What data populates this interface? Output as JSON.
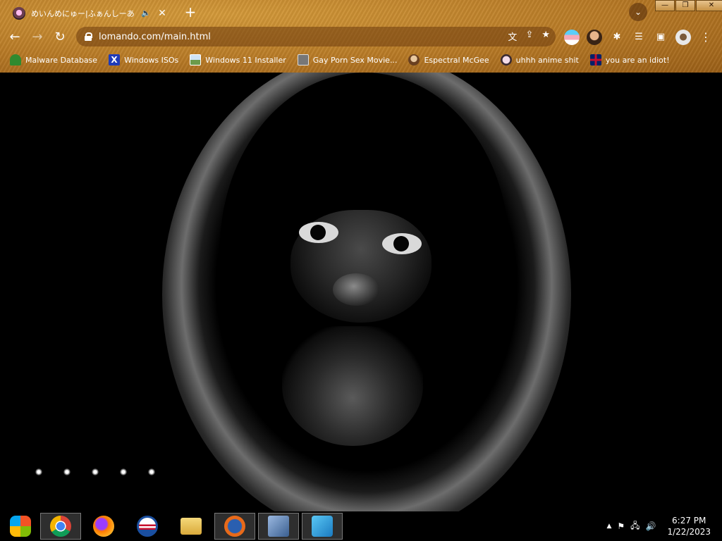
{
  "tab": {
    "title": "めいんめにゅー|ふぁんしーあいらんど",
    "audio_icon": "speaker-icon",
    "close_glyph": "✕"
  },
  "newtab_glyph": "+",
  "tabsearch_glyph": "⌄",
  "window_controls": {
    "minimize": "—",
    "restore": "❐",
    "close": "✕"
  },
  "nav": {
    "back": "←",
    "forward": "→",
    "reload": "↻"
  },
  "omnibox": {
    "url": "lomando.com/main.html"
  },
  "omnibox_icons": {
    "translate": "文",
    "share": "⇪",
    "bookmark": "★"
  },
  "toolbar_icons": {
    "extensions": "✱",
    "reading_list": "☰",
    "side_panel": "▣",
    "profile": "●",
    "menu": "⋮"
  },
  "bookmarks": [
    {
      "label": "Malware Database",
      "icon": "green-folder-icon",
      "color": "#2f8a2f"
    },
    {
      "label": "Windows ISOs",
      "icon": "x-logo-icon",
      "color": "#1f3bb8"
    },
    {
      "label": "Windows 11 Installer",
      "icon": "landscape-image-icon",
      "color": "#6b9b4b"
    },
    {
      "label": "Gay Porn Sex Movie...",
      "icon": "box-icon",
      "color": "#777777"
    },
    {
      "label": "Espectral McGee",
      "icon": "avatar-icon",
      "color": "#a06b3a"
    },
    {
      "label": "uhhh anime shit",
      "icon": "anime-face-icon",
      "color": "#e8c8d8"
    },
    {
      "label": "you are an idiot!",
      "icon": "uk-flag-icon",
      "color": "#c8102e"
    }
  ],
  "loading_dots": 5,
  "taskbar": {
    "items": [
      {
        "name": "windows-start-icon",
        "color": "#1c7a2a",
        "active": false
      },
      {
        "name": "chrome-icon",
        "color": "#db4437",
        "active": true
      },
      {
        "name": "firefox-icon",
        "color": "#ff7a00",
        "active": false
      },
      {
        "name": "obama-logo-icon",
        "color": "#1a4fa0",
        "active": false
      },
      {
        "name": "file-explorer-icon",
        "color": "#e8c15a",
        "active": false
      },
      {
        "name": "firefox-classic-icon",
        "color": "#e86a1a",
        "active": true
      },
      {
        "name": "setup-installer-icon",
        "color": "#5a7fb0",
        "active": true
      },
      {
        "name": "remote-desktop-icon",
        "color": "#2aa0e0",
        "active": true
      }
    ],
    "tray_icons": {
      "show_hidden": "▲",
      "flag": "⚑",
      "network": "🖧",
      "volume": "🔊"
    },
    "time": "6:27 PM",
    "date": "1/22/2023"
  }
}
